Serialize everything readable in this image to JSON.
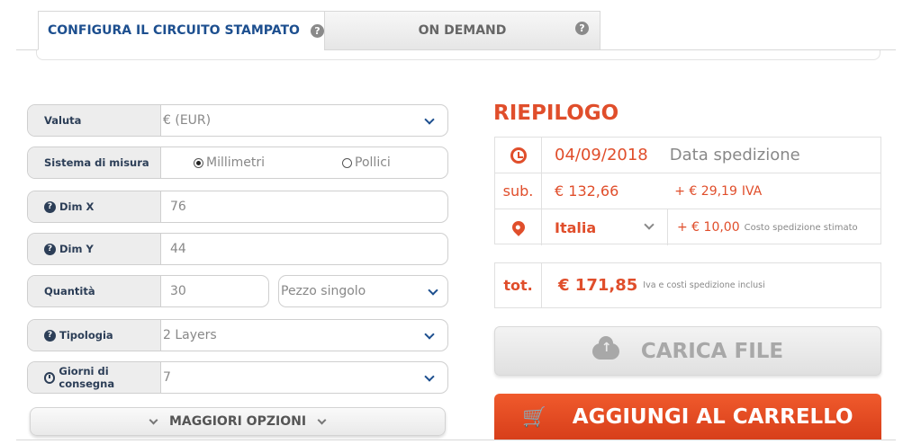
{
  "tabs": [
    {
      "label": "CONFIGURA IL CIRCUITO STAMPATO",
      "active": true
    },
    {
      "label": "ON DEMAND",
      "active": false
    }
  ],
  "form": {
    "currency": {
      "label": "Valuta",
      "value": "€ (EUR)"
    },
    "units": {
      "label": "Sistema di misura",
      "options": [
        "Millimetri",
        "Pollici"
      ],
      "selected": "Millimetri"
    },
    "dim_x": {
      "label": "Dim X",
      "value": "76"
    },
    "dim_y": {
      "label": "Dim Y",
      "value": "44"
    },
    "quantity": {
      "label": "Quantità",
      "value": "30",
      "mode": "Pezzo singolo"
    },
    "type": {
      "label": "Tipologia",
      "value": "2 Layers"
    },
    "delivery_days": {
      "label": "Giorni di consegna",
      "value": "7"
    },
    "more_options_label": "MAGGIORI OPZIONI"
  },
  "summary": {
    "title": "RIEPILOGO",
    "ship_date": "04/09/2018",
    "ship_date_label": "Data spedizione",
    "sub_label": "sub.",
    "subtotal": "€ 132,66",
    "vat": "+ € 29,19",
    "vat_label": "IVA",
    "country": "Italia",
    "shipping": "+ € 10,00",
    "shipping_label": "Costo spedizione stimato",
    "tot_label": "tot.",
    "total": "€ 171,85",
    "total_note": "Iva e costi spedizione inclusi"
  },
  "buttons": {
    "upload": "CARICA FILE",
    "add_to_cart": "AGGIUNGI AL CARRELLO"
  },
  "colors": {
    "accent": "#e04e2b",
    "brand_blue": "#1d4f8f"
  }
}
